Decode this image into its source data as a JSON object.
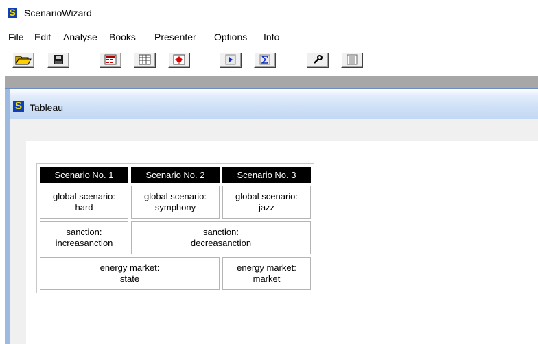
{
  "app": {
    "title": "ScenarioWizard",
    "logo_letter": "S"
  },
  "menu": {
    "items": [
      "File",
      "Edit",
      "Analyse",
      "Books",
      "Presenter",
      "Options",
      "Info"
    ]
  },
  "toolbar": {
    "buttons": [
      {
        "icon": "open-folder-icon"
      },
      {
        "icon": "save-disk-icon"
      },
      {
        "icon": "red-grid-icon"
      },
      {
        "icon": "table-grid-icon"
      },
      {
        "icon": "red-star-icon"
      },
      {
        "icon": "play-icon"
      },
      {
        "icon": "sigma-icon"
      },
      {
        "icon": "wrench-icon"
      },
      {
        "icon": "document-lines-icon"
      }
    ]
  },
  "child_window": {
    "title": "Tableau",
    "logo_letter": "S"
  },
  "tableau": {
    "headers": [
      "Scenario No. 1",
      "Scenario No. 2",
      "Scenario No. 3"
    ],
    "row1": [
      {
        "line1": "global scenario:",
        "line2": "hard"
      },
      {
        "line1": "global scenario:",
        "line2": "symphony"
      },
      {
        "line1": "global scenario:",
        "line2": "jazz"
      }
    ],
    "row2": [
      {
        "line1": "sanction:",
        "line2": "increasanction"
      },
      {
        "line1": "sanction:",
        "line2": "decreasanction"
      }
    ],
    "row3": [
      {
        "line1": "energy market:",
        "line2": "state"
      },
      {
        "line1": "energy market:",
        "line2": "market"
      }
    ]
  },
  "colors": {
    "logo_bg": "#0f3fbd",
    "logo_fg": "#f6e400",
    "header_bg": "#000000",
    "header_fg": "#ffffff"
  }
}
